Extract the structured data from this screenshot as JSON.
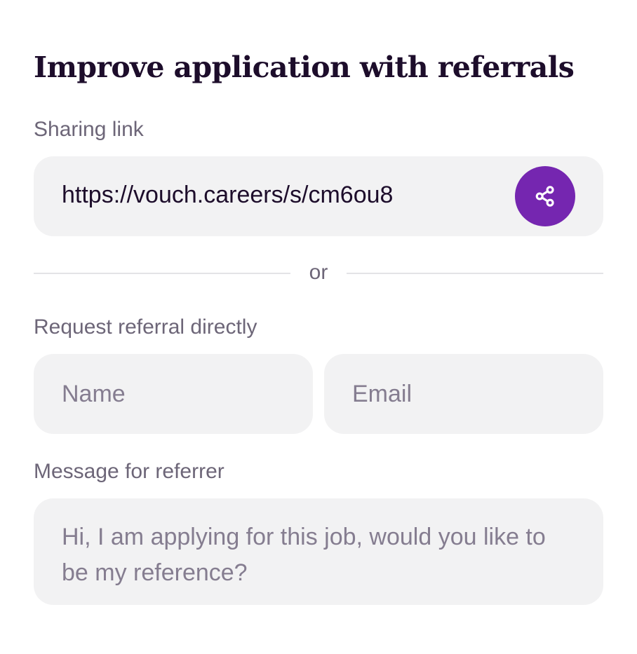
{
  "title": "Improve application with referrals",
  "sharing": {
    "label": "Sharing link",
    "url": "https://vouch.careers/s/cm6ou8",
    "share_icon": "share-icon"
  },
  "divider": {
    "text": "or"
  },
  "request": {
    "label": "Request referral directly",
    "name_placeholder": "Name",
    "email_placeholder": "Email"
  },
  "message": {
    "label": "Message for referrer",
    "placeholder": "Hi, I am applying for this job, would you like to be my reference?"
  },
  "colors": {
    "accent": "#7526b0",
    "field_background": "#f2f2f3",
    "muted_text": "#6d6678",
    "heading_text": "#1d0d2b"
  }
}
